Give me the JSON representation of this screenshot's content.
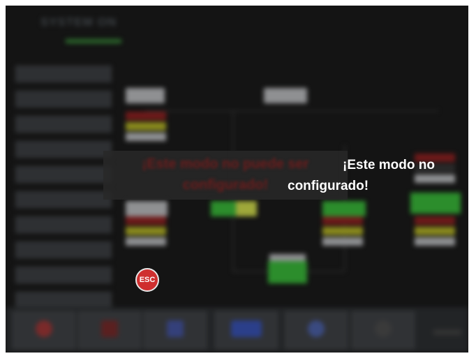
{
  "system": {
    "title": "SYSTEM ON"
  },
  "dialog": {
    "message_line1": "¡Este modo no",
    "message_line2": "configurado!",
    "ghost_line1": "¡Este modo no puede ser",
    "ghost_line2": "configurado!",
    "esc_label": "ESC"
  },
  "colors": {
    "accent_green": "#2c8d2c",
    "esc_red": "#cf2f2f"
  },
  "icons": [
    "esc-icon"
  ]
}
